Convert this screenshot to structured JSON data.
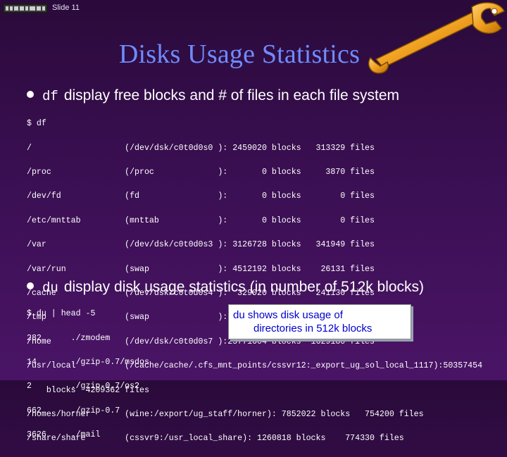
{
  "header": {
    "slide_number": "Slide 11"
  },
  "title": "Disks Usage Statistics",
  "bullets": [
    {
      "command": "df",
      "text": "display free blocks and # of files in each file system"
    },
    {
      "command": "du",
      "text": "display disk usage statistics (in number of 512k blocks)"
    }
  ],
  "df_output": [
    "$ df",
    "/                   (/dev/dsk/c0t0d0s0 ): 2459020 blocks   313329 files",
    "/proc               (/proc             ):       0 blocks     3870 files",
    "/dev/fd             (fd                ):       0 blocks        0 files",
    "/etc/mnttab         (mnttab            ):       0 blocks        0 files",
    "/var                (/dev/dsk/c0t0d0s3 ): 3126728 blocks   341949 files",
    "/var/run            (swap              ): 4512192 blocks    26131 files",
    "/cache              (/dev/dsk/c0t0d0s4 ):  329020 blocks   241130 files",
    "/tmp                (swap              ): 4512192 blocks    26131 files",
    "/home               (/dev/dsk/c0t0d0s7 ):25771604 blocks  1629180 files",
    "/usr/local          (/cache/cache/.cfs_mnt_points/cssvr12:_export_ug_sol_local_1117):50357454",
    "    blocks  4209362 files",
    "/homes/horner       (wine:/export/ug_staff/horner): 7852022 blocks   754200 files",
    "/share/share        (cssvr9:/usr_local_share): 1260818 blocks    774330 files"
  ],
  "du_output": [
    "$ du | head -5",
    "282      ./zmodem",
    "14       ./gzip-0.7/msdos",
    "2        ./gzip-0.7/os2",
    "662      ./gzip-0.7",
    "3626     ./mail"
  ],
  "callout": {
    "line1": "du shows disk usage of",
    "line2": "directories in 512k blocks"
  },
  "colors": {
    "title": "#6f8bff",
    "background": "#3a0f52",
    "callout_text": "#0000cc"
  }
}
